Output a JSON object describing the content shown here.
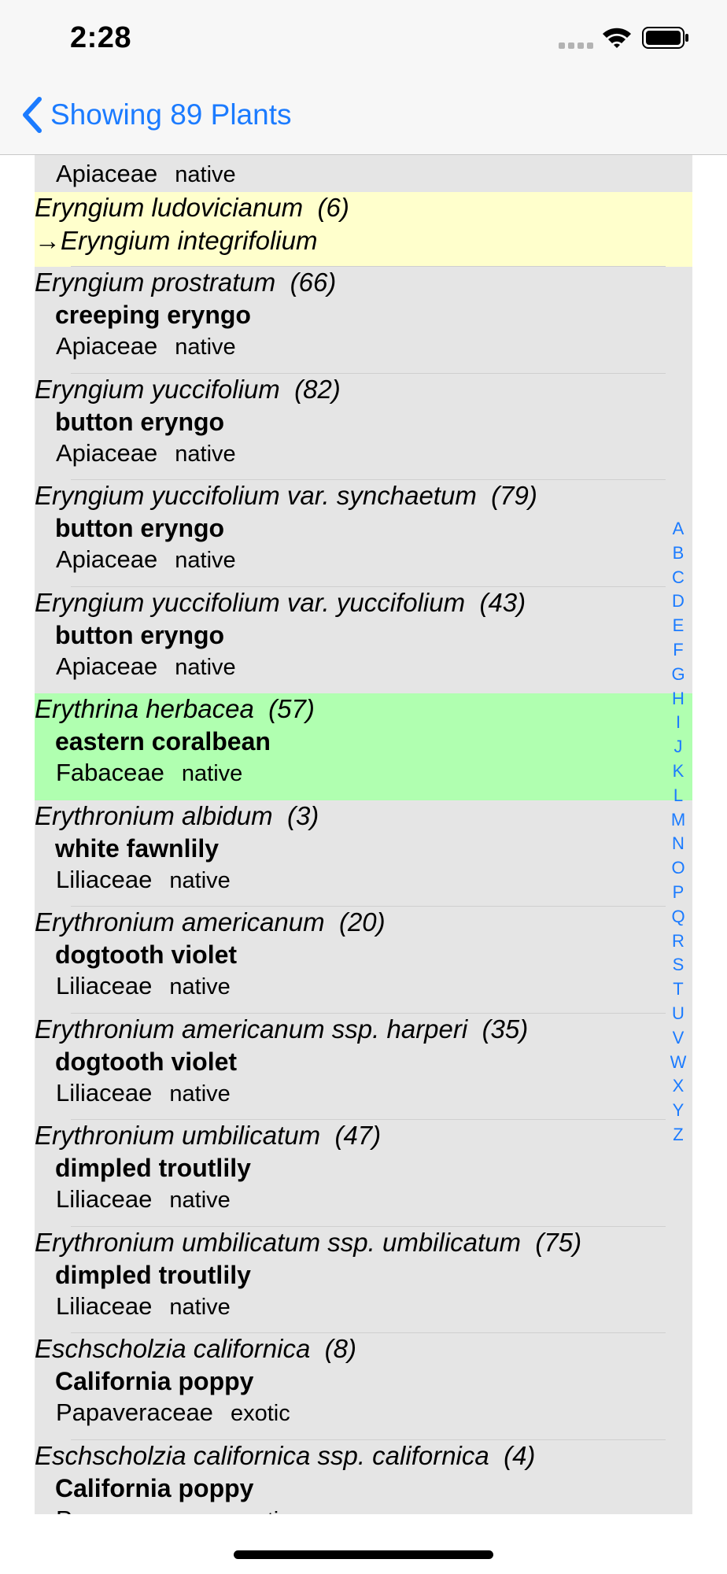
{
  "status_bar": {
    "time": "2:28",
    "icons": [
      "signal-icon",
      "wifi-icon",
      "battery-icon"
    ]
  },
  "nav": {
    "back_label": "Showing 89 Plants",
    "accent_color": "#1b7bff"
  },
  "colors": {
    "list_background": "#e5e5e5",
    "highlight_yellow": "#ffffcc",
    "highlight_green": "#b0ffb0"
  },
  "rows": [
    {
      "scientific": "",
      "count": "",
      "common": "",
      "family": "Apiaceae",
      "status": "native",
      "partial": true
    },
    {
      "scientific": "Eryngium ludovicianum",
      "count": "(6)",
      "redirect": "Eryngium integrifolium",
      "highlight": "yellow"
    },
    {
      "scientific": "Eryngium prostratum",
      "count": "(66)",
      "common": "creeping eryngo",
      "family": "Apiaceae",
      "status": "native"
    },
    {
      "scientific": "Eryngium yuccifolium",
      "count": "(82)",
      "common": "button eryngo",
      "family": "Apiaceae",
      "status": "native"
    },
    {
      "scientific": "Eryngium yuccifolium var. synchaetum",
      "count": "(79)",
      "common": "button eryngo",
      "family": "Apiaceae",
      "status": "native"
    },
    {
      "scientific": "Eryngium yuccifolium var. yuccifolium",
      "count": "(43)",
      "common": "button eryngo",
      "family": "Apiaceae",
      "status": "native"
    },
    {
      "scientific": "Erythrina herbacea",
      "count": "(57)",
      "common": "eastern coralbean",
      "family": "Fabaceae",
      "status": "native",
      "highlight": "green"
    },
    {
      "scientific": "Erythronium albidum",
      "count": "(3)",
      "common": "white fawnlily",
      "family": "Liliaceae",
      "status": "native"
    },
    {
      "scientific": "Erythronium americanum",
      "count": "(20)",
      "common": "dogtooth violet",
      "family": "Liliaceae",
      "status": "native"
    },
    {
      "scientific": "Erythronium americanum ssp. harperi",
      "count": "(35)",
      "common": "dogtooth violet",
      "family": "Liliaceae",
      "status": "native"
    },
    {
      "scientific": "Erythronium umbilicatum",
      "count": "(47)",
      "common": "dimpled troutlily",
      "family": "Liliaceae",
      "status": "native"
    },
    {
      "scientific": "Erythronium umbilicatum ssp. umbilicatum",
      "count": "(75)",
      "common": "dimpled troutlily",
      "family": "Liliaceae",
      "status": "native"
    },
    {
      "scientific": "Eschscholzia californica",
      "count": "(8)",
      "common": "California poppy",
      "family": "Papaveraceae",
      "status": "exotic"
    },
    {
      "scientific": "Eschscholzia californica ssp. californica",
      "count": "(4)",
      "common": "California poppy",
      "family": "Papaveraceae",
      "status": "exotic"
    }
  ],
  "index_letters": [
    "A",
    "B",
    "C",
    "D",
    "E",
    "F",
    "G",
    "H",
    "I",
    "J",
    "K",
    "L",
    "M",
    "N",
    "O",
    "P",
    "Q",
    "R",
    "S",
    "T",
    "U",
    "V",
    "W",
    "X",
    "Y",
    "Z"
  ]
}
